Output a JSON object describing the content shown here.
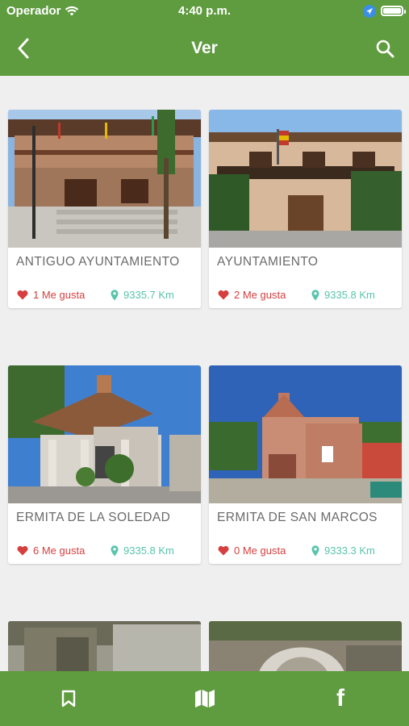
{
  "status_bar": {
    "carrier": "Operador",
    "time": "4:40 p.m."
  },
  "nav": {
    "title": "Ver",
    "back_icon": "chevron-left-icon",
    "search_icon": "search-icon"
  },
  "places": [
    {
      "title": "ANTIGUO AYUNTAMIENTO",
      "likes": "1 Me gusta",
      "distance": "9335.7 Km",
      "photo": "town-hall-wooden-balcony"
    },
    {
      "title": "AYUNTAMIENTO",
      "likes": "2 Me gusta",
      "distance": "9335.8 Km",
      "photo": "town-hall-flags"
    },
    {
      "title": "ERMITA DE LA SOLEDAD",
      "likes": "6 Me gusta",
      "distance": "9335.8 Km",
      "photo": "stone-chapel"
    },
    {
      "title": "ERMITA DE SAN MARCOS",
      "likes": "0 Me gusta",
      "distance": "9333.3 Km",
      "photo": "brick-chapel"
    },
    {
      "title": "",
      "likes": "",
      "distance": "",
      "photo": "dry-vegetation"
    },
    {
      "title": "",
      "likes": "",
      "distance": "",
      "photo": "stone-arch-fountain"
    }
  ],
  "tab_bar": {
    "tabs": [
      {
        "icon": "bookmark-icon"
      },
      {
        "icon": "map-icon"
      },
      {
        "icon": "facebook-icon",
        "letter": "f"
      }
    ]
  },
  "colors": {
    "brand_green": "#5f9b3f",
    "like_red": "#d63f3f",
    "distance_teal": "#58c4ac",
    "background": "#efefef"
  }
}
